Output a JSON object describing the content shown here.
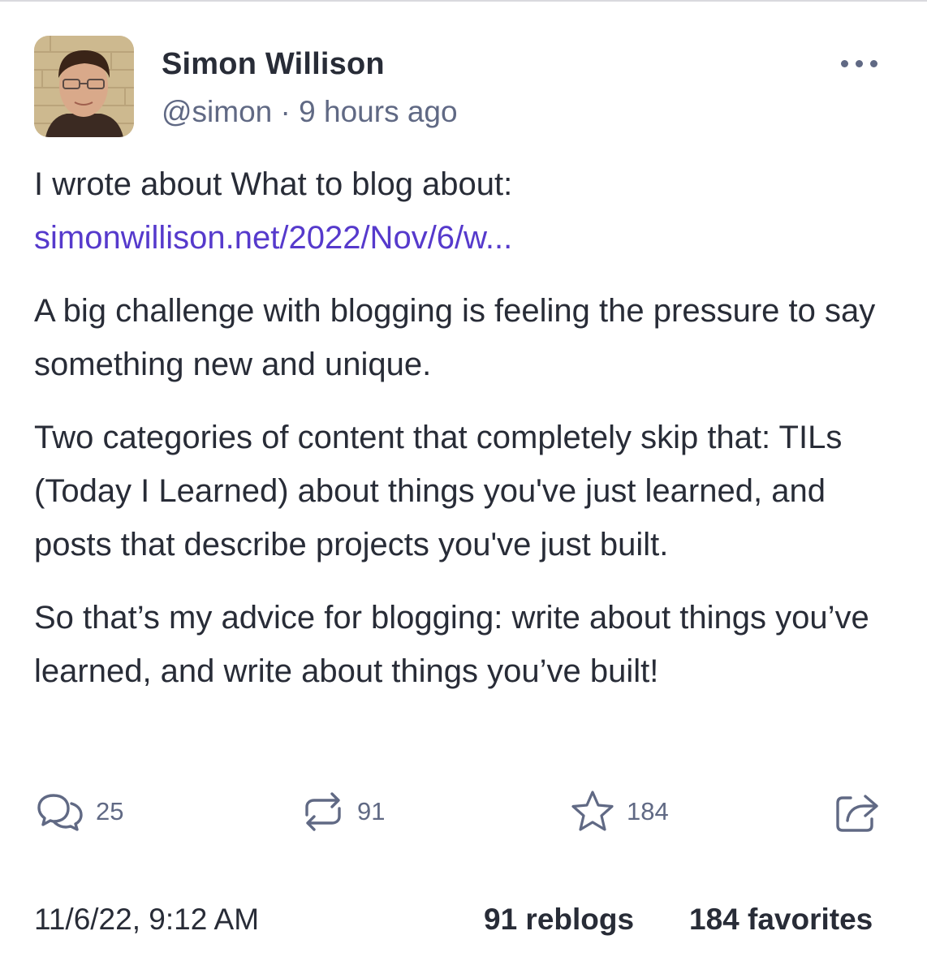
{
  "author": {
    "display_name": "Simon Willison",
    "handle": "@simon",
    "separator": "·",
    "time_ago": "9 hours ago",
    "avatar_icon": "profile-photo"
  },
  "post": {
    "intro": "I wrote about What to blog about:",
    "link": "simonwillison.net/2022/Nov/6/w...",
    "paragraphs": [
      "A big challenge with blogging is feeling the pressure to say something new and unique.",
      "Two categories of content that completely skip that: TILs (Today I Learned) about things you've just learned, and posts that describe projects you've just built.",
      "So that’s my advice for blogging: write about things you’ve learned, and write about things you’ve built!"
    ]
  },
  "actions": {
    "replies": {
      "count": "25",
      "icon": "reply-icon"
    },
    "reblogs": {
      "count": "91",
      "icon": "reblog-icon"
    },
    "favorites": {
      "count": "184",
      "icon": "star-icon"
    },
    "share": {
      "icon": "share-icon"
    }
  },
  "footer": {
    "timestamp": "11/6/22, 9:12 AM",
    "reblogs_label": "91 reblogs",
    "favorites_label": "184 favorites"
  },
  "colors": {
    "text": "#282c37",
    "muted": "#606984",
    "link": "#563acc",
    "background": "#ffffff"
  }
}
